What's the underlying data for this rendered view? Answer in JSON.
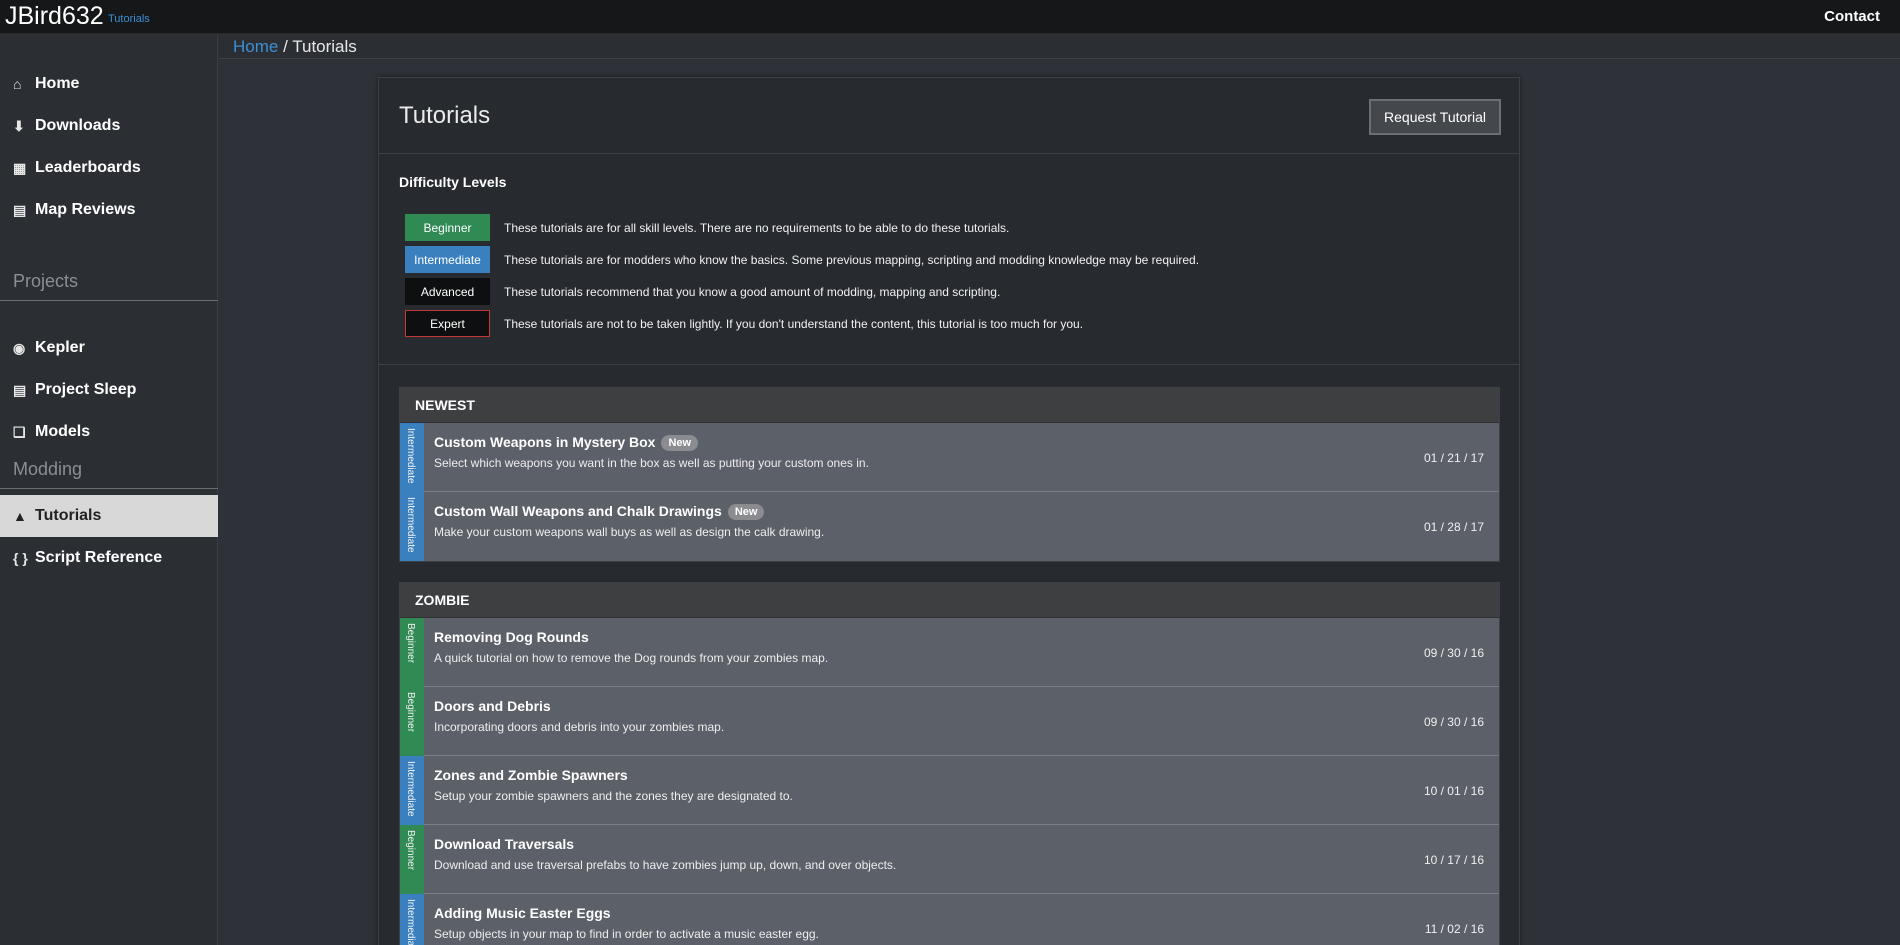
{
  "header": {
    "brand": "JBird632",
    "brand_sub": "Tutorials",
    "contact": "Contact"
  },
  "sidebar": {
    "main_items": [
      {
        "label": "Home",
        "icon": "home-icon"
      },
      {
        "label": "Downloads",
        "icon": "download-icon"
      },
      {
        "label": "Leaderboards",
        "icon": "table-icon"
      },
      {
        "label": "Map Reviews",
        "icon": "map-icon"
      }
    ],
    "projects_title": "Projects",
    "project_items": [
      {
        "label": "Kepler",
        "icon": "globe-icon"
      },
      {
        "label": "Project Sleep",
        "icon": "bed-icon"
      },
      {
        "label": "Models",
        "icon": "cube-icon"
      }
    ],
    "modding_title": "Modding",
    "modding_items": [
      {
        "label": "Tutorials",
        "icon": "graduation-cap-icon",
        "active": true
      },
      {
        "label": "Script Reference",
        "icon": "braces-icon",
        "active": false
      }
    ]
  },
  "breadcrumb": {
    "home": "Home",
    "separator": " / ",
    "current": "Tutorials"
  },
  "panel": {
    "title": "Tutorials",
    "request_button": "Request Tutorial",
    "difficulty_title": "Difficulty Levels",
    "difficulties": [
      {
        "label": "Beginner",
        "desc": "These tutorials are for all skill levels. There are no requirements to be able to do these tutorials."
      },
      {
        "label": "Intermediate",
        "desc": "These tutorials are for modders who know the basics. Some previous mapping, scripting and modding knowledge may be required."
      },
      {
        "label": "Advanced",
        "desc": "These tutorials recommend that you know a good amount of modding, mapping and scripting."
      },
      {
        "label": "Expert",
        "desc": "These tutorials are not to be taken lightly. If you don't understand the content, this tutorial is too much for you."
      }
    ]
  },
  "colors": {
    "beginner": "#2f8a54",
    "intermediate": "#3a80be",
    "advanced": "#0e0f10",
    "expert_border": "#c03a3a",
    "link": "#3d8fd6"
  },
  "categories": [
    {
      "title": "NEWEST",
      "tutorials": [
        {
          "level": "Intermediate",
          "title": "Custom Weapons in Mystery Box",
          "is_new": true,
          "new_label": "New",
          "desc": "Select which weapons you want in the box as well as putting your custom ones in.",
          "date": "01 / 21 / 17"
        },
        {
          "level": "Intermediate",
          "title": "Custom Wall Weapons and Chalk Drawings",
          "is_new": true,
          "new_label": "New",
          "desc": "Make your custom weapons wall buys as well as design the calk drawing.",
          "date": "01 / 28 / 17"
        }
      ]
    },
    {
      "title": "ZOMBIE",
      "tutorials": [
        {
          "level": "Beginner",
          "title": "Removing Dog Rounds",
          "is_new": false,
          "desc": "A quick tutorial on how to remove the Dog rounds from your zombies map.",
          "date": "09 / 30 / 16"
        },
        {
          "level": "Beginner",
          "title": "Doors and Debris",
          "is_new": false,
          "desc": "Incorporating doors and debris into your zombies map.",
          "date": "09 / 30 / 16"
        },
        {
          "level": "Intermediate",
          "title": "Zones and Zombie Spawners",
          "is_new": false,
          "desc": "Setup your zombie spawners and the zones they are designated to.",
          "date": "10 / 01 / 16"
        },
        {
          "level": "Beginner",
          "title": "Download Traversals",
          "is_new": false,
          "desc": "Download and use traversal prefabs to have zombies jump up, down, and over objects.",
          "date": "10 / 17 / 16"
        },
        {
          "level": "Intermediate",
          "title": "Adding Music Easter Eggs",
          "is_new": false,
          "desc": "Setup objects in your map to find in order to activate a music easter egg.",
          "date": "11 / 02 / 16"
        }
      ]
    }
  ]
}
